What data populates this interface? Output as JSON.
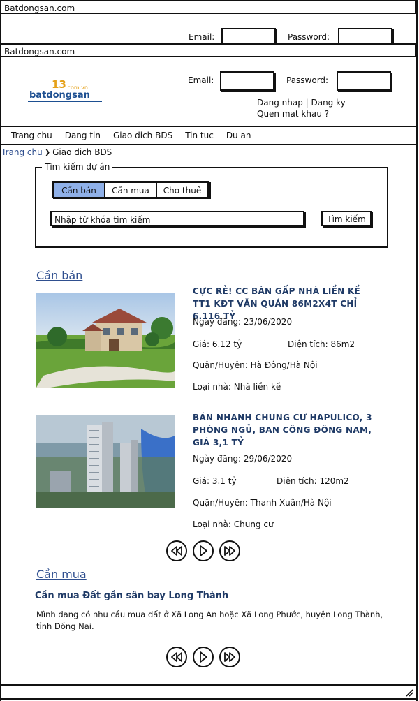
{
  "window": {
    "title": "Batdongsan.com"
  },
  "header": {
    "logo_text": "batdongsan",
    "logo_sub": ".com.vn",
    "email_label": "Email:",
    "password_label": "Password:",
    "links": "Dang nhap | Dang ky",
    "forgot": "Quen mat khau ?"
  },
  "nav": {
    "items": [
      "Trang chu",
      "Dang tin",
      "Giao dich BDS",
      "Tin tuc",
      "Du an"
    ]
  },
  "breadcrumb": {
    "home": "Trang chu",
    "current": "Giao dich BDS"
  },
  "search": {
    "legend": "Tìm kiếm dự án",
    "tabs": [
      "Cần bán",
      "Cần mua",
      "Cho thuê"
    ],
    "placeholder": "Nhập từ khóa tìm kiếm",
    "button": "Tìm kiếm"
  },
  "sell": {
    "heading": "Cần bán",
    "listings": [
      {
        "title": "Cực rẻ! CC bán gấp nhà liền kề TT1 KĐT Văn Quán 86m2x4T chỉ 6.116 tỷ",
        "date": "Ngày đăng: 23/06/2020",
        "price": "Giá: 6.12 tỷ",
        "area": "Diện tích: 86m2",
        "district": "Quận/Huyện: Hà Đông/Hà Nội",
        "type": "Loại nhà: Nhà liền kề"
      },
      {
        "title": "Bán nhanh chung cư Hapulico, 3 phòng ngủ, ban công Đông Nam, giá 3,1 tỷ",
        "date": "Ngày đăng: 29/06/2020",
        "price": "Giá: 3.1 tỷ",
        "area": "Diện tích: 120m2",
        "district": "Quận/Huyện: Thanh Xuân/Hà Nội",
        "type": "Loại nhà: Chung cư"
      }
    ]
  },
  "buy": {
    "heading": "Cần mua",
    "title": "Cần mua Đất gần sân bay Long Thành",
    "body": "Mình đang có nhu cầu mua đất ở Xã Long An hoặc Xã Long Phước, huyện Long Thành, tỉnh Đồng Nai."
  },
  "colors": {
    "accent": "#2f4f8f",
    "tab_active": "#8fb0e8",
    "title": "#1f3a66"
  }
}
